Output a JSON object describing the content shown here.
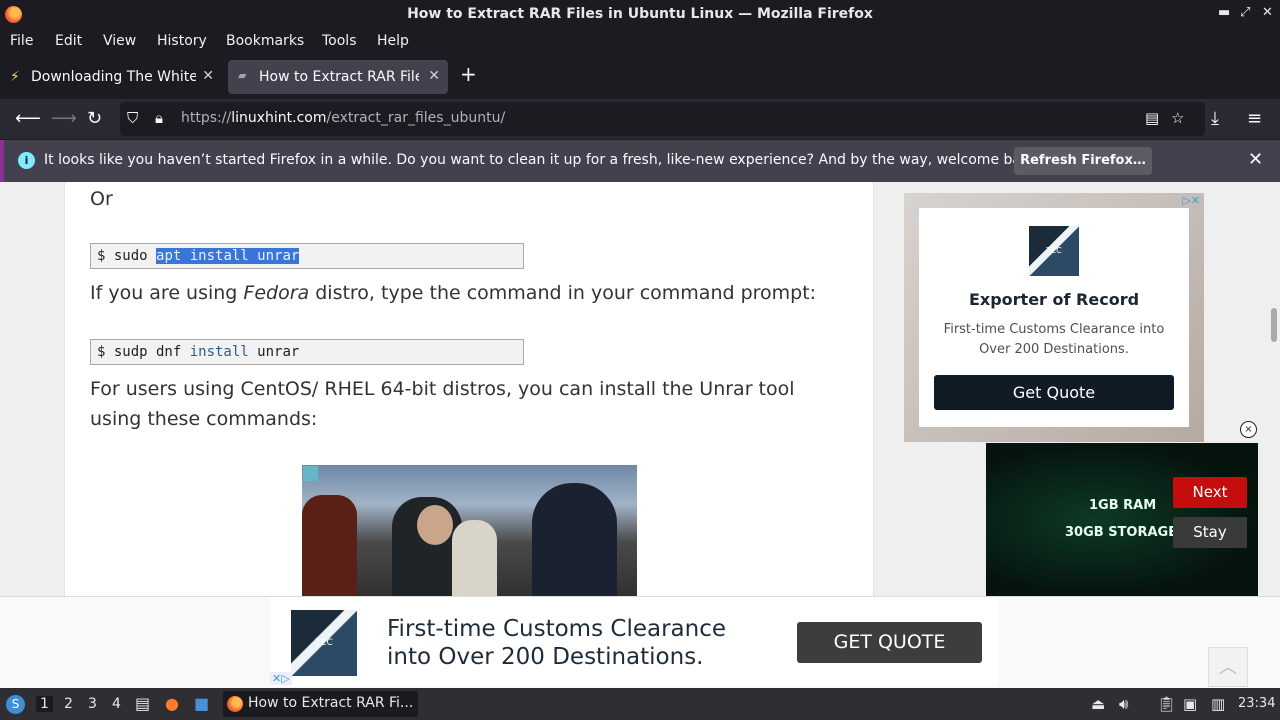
{
  "window": {
    "title": "How to Extract RAR Files in Ubuntu Linux — Mozilla Firefox",
    "controls": {
      "minimize": "▬",
      "maximize": "⤢",
      "close": "✕"
    }
  },
  "menubar": {
    "items": [
      "File",
      "Edit",
      "View",
      "History",
      "Bookmarks",
      "Tools",
      "Help"
    ]
  },
  "tabs": [
    {
      "label": "Downloading The White H",
      "icon": "lightning-icon",
      "active": false
    },
    {
      "label": "How to Extract RAR Files",
      "icon": "linuxhint-favicon",
      "active": true
    }
  ],
  "new_tab_label": "+",
  "nav": {
    "url_prefix": "https://",
    "url_domain": "linuxhint.com",
    "url_path": "/extract_rar_files_ubuntu/"
  },
  "notification": {
    "message": "It looks like you haven’t started Firefox in a while. Do you want to clean it up for a fresh, like-new experience? And by the way, welcome back!",
    "button": "Refresh Firefox…",
    "info_glyph": "i"
  },
  "article": {
    "or_text": "Or",
    "code1_prefix": "$ sudo ",
    "code1_selected": "apt install unrar",
    "para_fedora_before": "If you are using ",
    "para_fedora_em": "Fedora",
    "para_fedora_after": " distro, type the command in your command prompt:",
    "code2_prefix": "$ sudp dnf ",
    "code2_kw": "install",
    "code2_suffix": " unrar",
    "para_centos": "For users using CentOS/ RHEL 64-bit distros, you can install the Unrar tool using these commands:"
  },
  "side_ad": {
    "logo_text": "TEC",
    "heading": "Exporter of Record",
    "sub": "First-time Customs Clearance into Over 200 Destinations.",
    "button": "Get Quote",
    "adchoices": "▷✕",
    "close_glyph": "×"
  },
  "video_ad": {
    "line1": "1GB RAM",
    "line2": "30GB STORAGE",
    "next": "Next",
    "stay": "Stay"
  },
  "bottom_ad": {
    "logo_text": "TEC",
    "text": "First-time Customs Clearance into Over 200 Destinations.",
    "button": "GET QUOTE",
    "adchoices": "✕▷",
    "scroll_top": "︿"
  },
  "taskbar": {
    "workspaces": [
      "1",
      "2",
      "3",
      "4"
    ],
    "active_workspace": "1",
    "task_label": "How to Extract RAR Fi...",
    "clock": "23:34"
  }
}
